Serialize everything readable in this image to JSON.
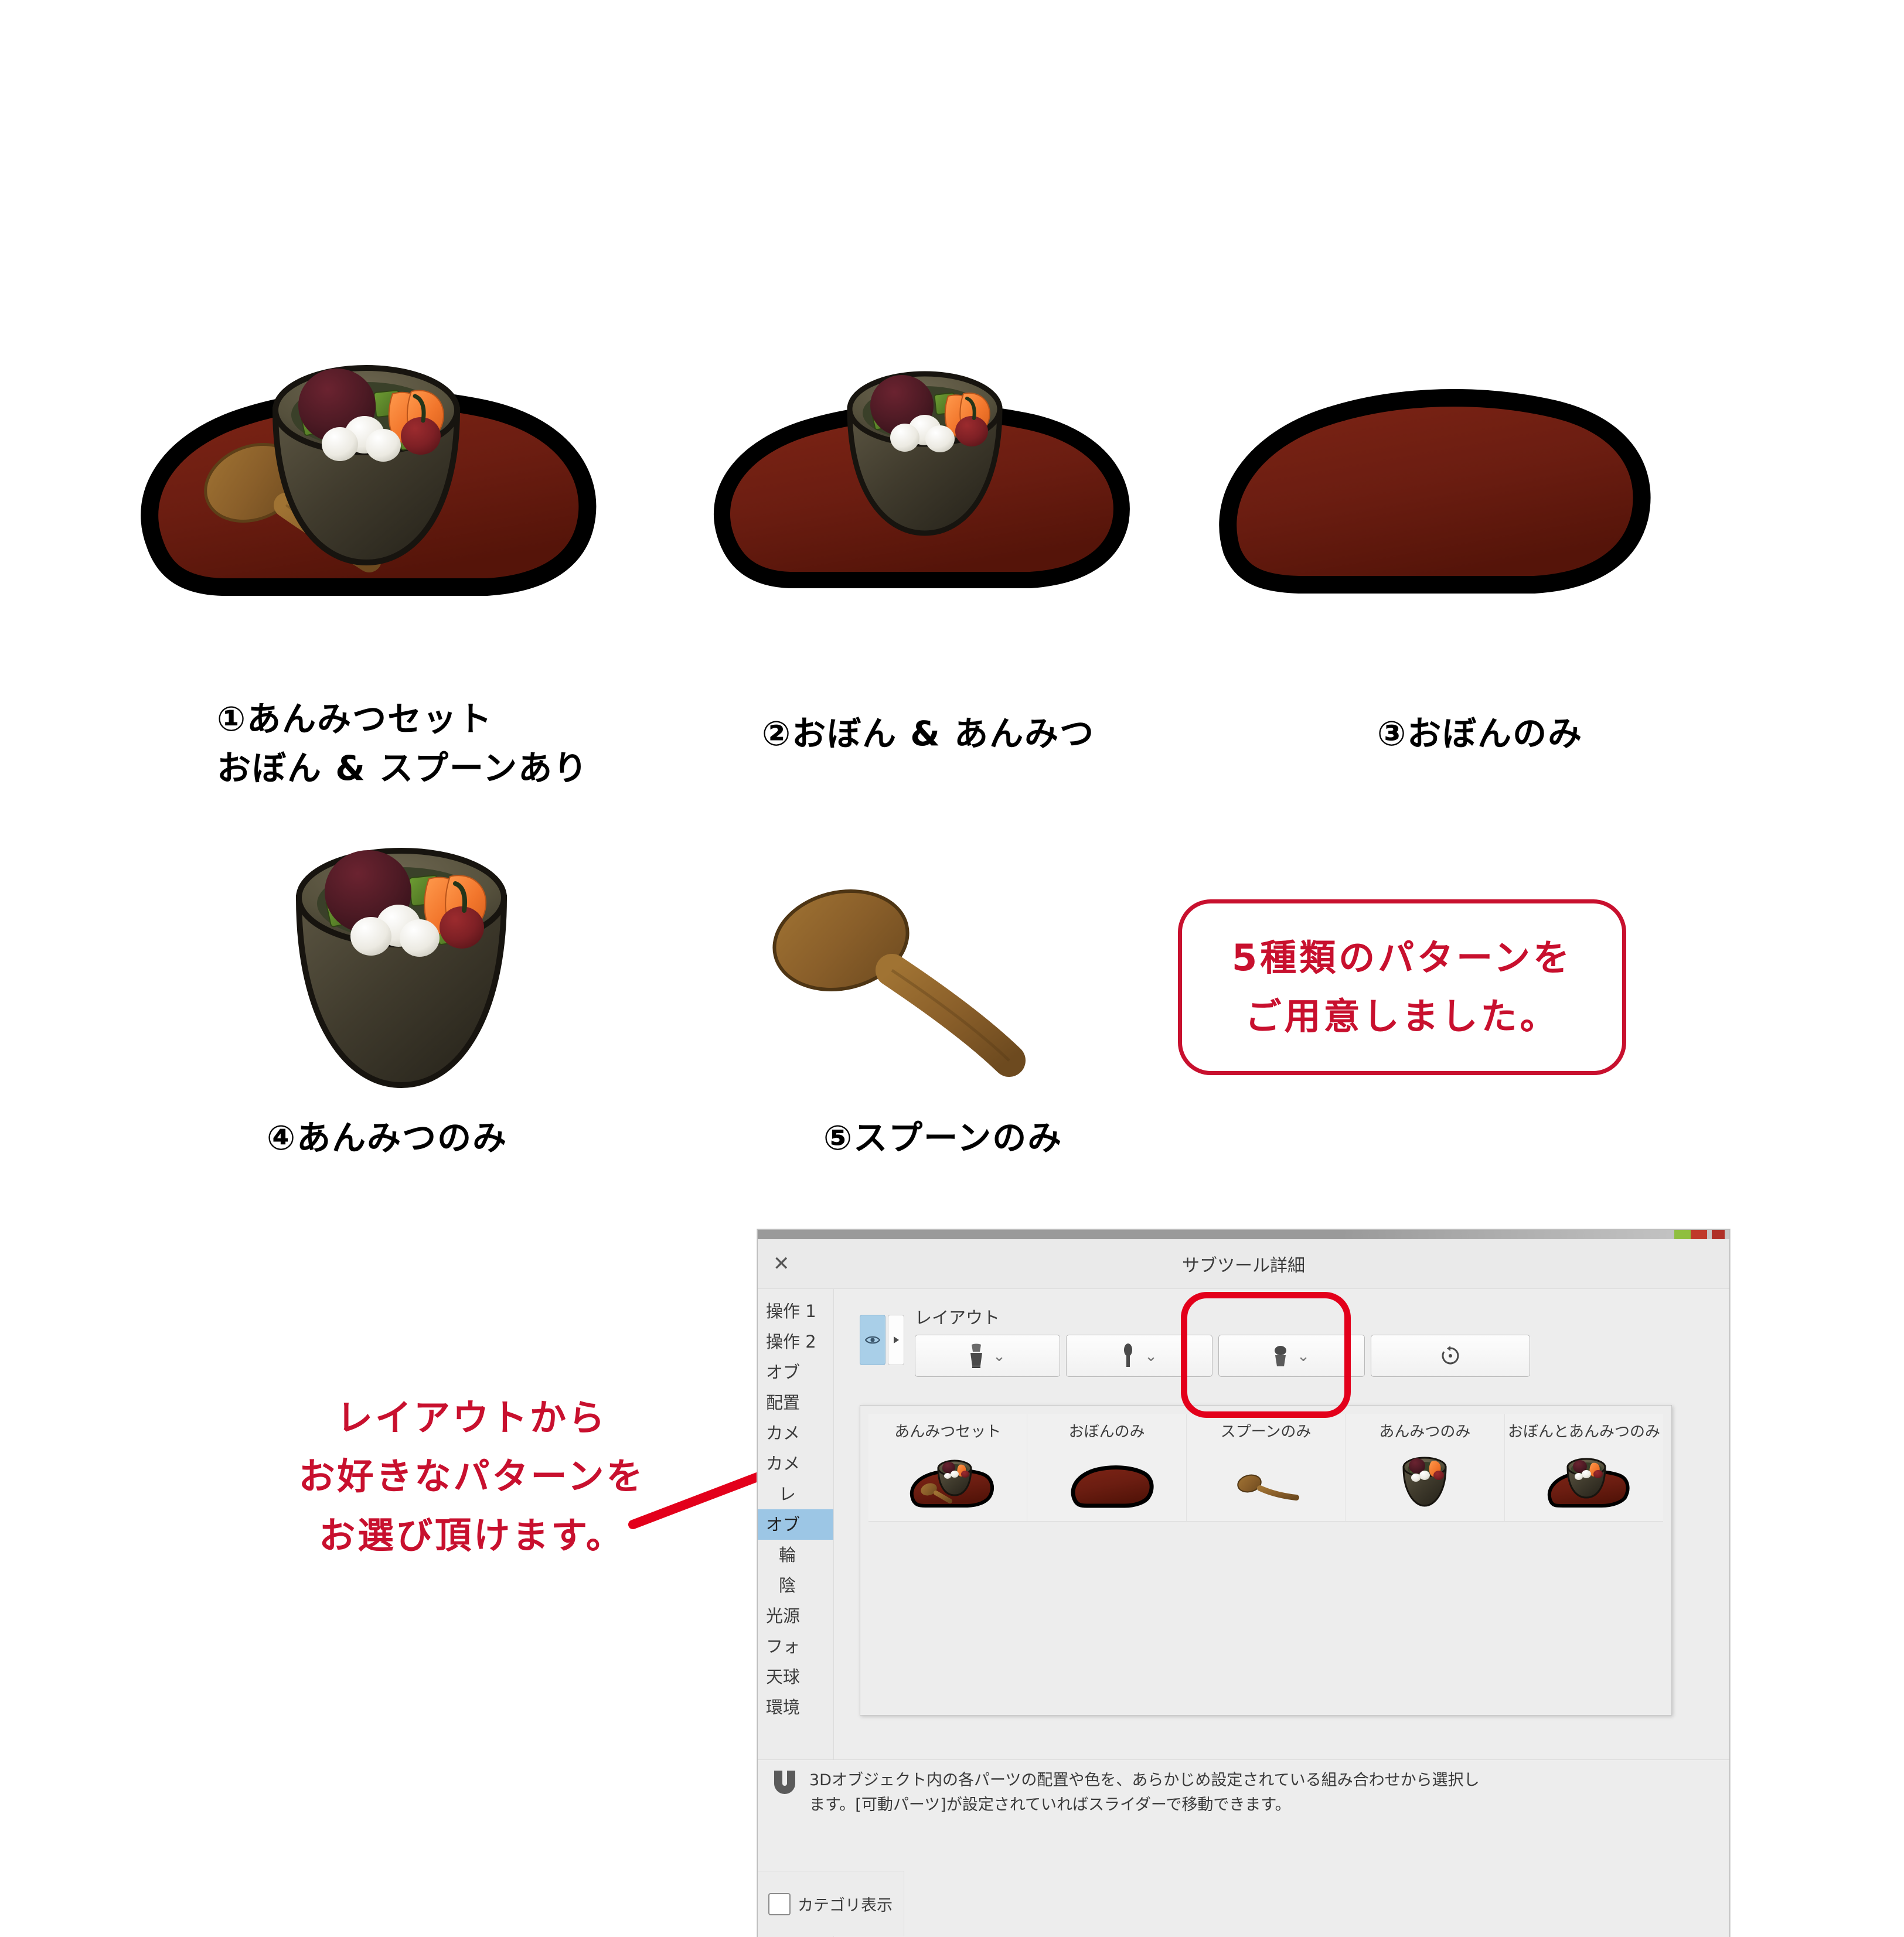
{
  "page": {
    "background": "#ffffff",
    "accent_red": "#c8102e",
    "highlight_red": "#e3001b",
    "tray_color": "#6b1d11",
    "bowl_color": "#4a4434",
    "spoon_color": "#8a5f2a"
  },
  "samples": [
    {
      "number": "①",
      "title": "①あんみつセット",
      "subtitle": "おぼん & スプーンあり",
      "contents": "tray + bowl + spoon"
    },
    {
      "number": "②",
      "title": "②おぼん & あんみつ",
      "subtitle": "",
      "contents": "tray + bowl"
    },
    {
      "number": "③",
      "title": "③おぼんのみ",
      "subtitle": "",
      "contents": "tray only"
    },
    {
      "number": "④",
      "title": "④あんみつのみ",
      "subtitle": "",
      "contents": "bowl only"
    },
    {
      "number": "⑤",
      "title": "⑤スプーンのみ",
      "subtitle": "",
      "contents": "spoon only"
    }
  ],
  "callout": {
    "line1": "5種類のパターンを",
    "line2": "ご用意しました。"
  },
  "left_note": {
    "line1": "レイアウトから",
    "line2": "お好きなパターンを",
    "line3": "お選び頂けます。"
  },
  "dialog": {
    "title": "サブツール詳細",
    "close_label": "✕",
    "sidebar": [
      {
        "label": "操作 1",
        "selected": false,
        "indent": false
      },
      {
        "label": "操作 2",
        "selected": false,
        "indent": false
      },
      {
        "label": "オブ",
        "selected": false,
        "indent": false
      },
      {
        "label": "配置",
        "selected": false,
        "indent": false
      },
      {
        "label": "カメ",
        "selected": false,
        "indent": false
      },
      {
        "label": "カメ",
        "selected": false,
        "indent": false
      },
      {
        "label": "レ",
        "selected": false,
        "indent": true
      },
      {
        "label": "オブ",
        "selected": true,
        "indent": false
      },
      {
        "label": "輪",
        "selected": false,
        "indent": true
      },
      {
        "label": "陰",
        "selected": false,
        "indent": true
      },
      {
        "label": "光源",
        "selected": false,
        "indent": false
      },
      {
        "label": "フォ",
        "selected": false,
        "indent": false
      },
      {
        "label": "天球",
        "selected": false,
        "indent": false
      },
      {
        "label": "環境",
        "selected": false,
        "indent": false
      }
    ],
    "layout_label": "レイアウト",
    "layout_buttons": [
      {
        "icon": "anmitsu-set-icon",
        "has_chevron": true,
        "highlighted": false
      },
      {
        "icon": "spoon-only-icon",
        "has_chevron": true,
        "highlighted": true
      },
      {
        "icon": "anmitsu-only-icon",
        "has_chevron": true,
        "highlighted": false
      },
      {
        "icon": "reset-icon",
        "has_chevron": false,
        "highlighted": false
      }
    ],
    "popup_presets": [
      {
        "label": "あんみつセット",
        "thumb": "tray-bowl-spoon"
      },
      {
        "label": "おぼんのみ",
        "thumb": "tray"
      },
      {
        "label": "スプーンのみ",
        "thumb": "spoon"
      },
      {
        "label": "あんみつのみ",
        "thumb": "bowl"
      },
      {
        "label": "おぼんとあんみつのみ",
        "thumb": "tray-bowl"
      }
    ],
    "description": {
      "line1": "3Dオブジェクト内の各パーツの配置や色を、あらかじめ設定されている組み合わせから選択し",
      "line2": "ます。[可動パーツ]が設定されていればスライダーで移動できます。"
    },
    "category_checkbox": {
      "label": "カテゴリ表示",
      "checked": false
    }
  }
}
